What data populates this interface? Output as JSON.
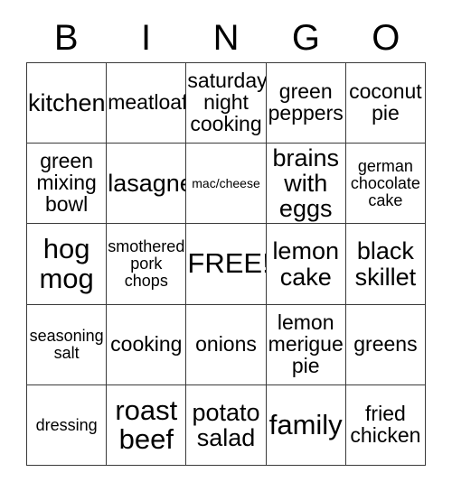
{
  "card": {
    "title": "BINGO",
    "header_letters": [
      "B",
      "I",
      "N",
      "G",
      "O"
    ],
    "free_space_label": "FREE!",
    "colors": {
      "background": "#ffffff",
      "text": "#000000",
      "grid_line": "#3a3a3a"
    },
    "rows": [
      [
        {
          "text": "kitchen",
          "size": "lg"
        },
        {
          "text": "meatloaf",
          "size": "md"
        },
        {
          "text": "saturday night cooking",
          "size": "md"
        },
        {
          "text": "green peppers",
          "size": "md"
        },
        {
          "text": "coconut pie",
          "size": "md"
        }
      ],
      [
        {
          "text": "green mixing bowl",
          "size": "md"
        },
        {
          "text": "lasagne",
          "size": "lg"
        },
        {
          "text": "mac/cheese",
          "size": "xs"
        },
        {
          "text": "brains with eggs",
          "size": "lg"
        },
        {
          "text": "german chocolate cake",
          "size": "sm"
        }
      ],
      [
        {
          "text": "hog mog",
          "size": "xl"
        },
        {
          "text": "smothered pork chops",
          "size": "sm"
        },
        {
          "text": "FREE!",
          "size": "xl"
        },
        {
          "text": "lemon cake",
          "size": "lg"
        },
        {
          "text": "black skillet",
          "size": "lg"
        }
      ],
      [
        {
          "text": "seasoning salt",
          "size": "sm"
        },
        {
          "text": "cooking",
          "size": "md"
        },
        {
          "text": "onions",
          "size": "md"
        },
        {
          "text": "lemon merigue pie",
          "size": "md"
        },
        {
          "text": "greens",
          "size": "md"
        }
      ],
      [
        {
          "text": "dressing",
          "size": "sm"
        },
        {
          "text": "roast beef",
          "size": "xl"
        },
        {
          "text": "potato salad",
          "size": "lg"
        },
        {
          "text": "family",
          "size": "xl"
        },
        {
          "text": "fried chicken",
          "size": "md"
        }
      ]
    ]
  }
}
